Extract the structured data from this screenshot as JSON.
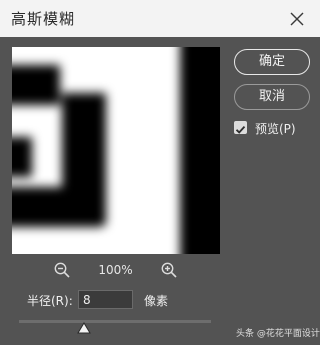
{
  "window": {
    "title": "高斯模糊"
  },
  "buttons": {
    "ok_label": "确定",
    "cancel_label": "取消"
  },
  "preview_option": {
    "label": "预览(P)",
    "checked": true
  },
  "zoom": {
    "level": "100%"
  },
  "radius": {
    "label": "半径(R):",
    "value": "8",
    "unit": "像素",
    "slider_position": 0.34
  },
  "watermark": {
    "text": "头条 @花花平面设计"
  },
  "colors": {
    "dialog_bg": "#535353",
    "titlebar_bg": "#f3f3f3",
    "preview_bg": "#ffffff"
  }
}
